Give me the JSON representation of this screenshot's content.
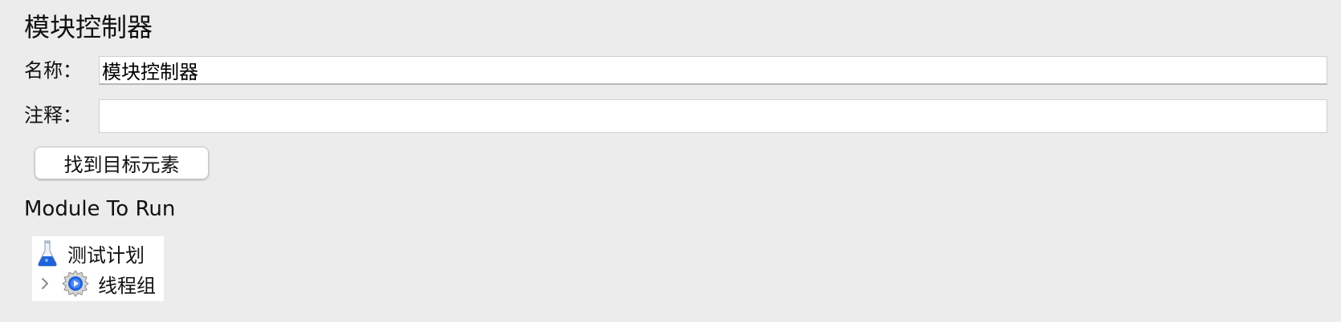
{
  "panel": {
    "title": "模块控制器",
    "name_label": "名称：",
    "name_value": "模块控制器",
    "comment_label": "注释：",
    "comment_value": "",
    "find_button_label": "找到目标元素",
    "module_section_label": "Module To Run"
  },
  "tree": {
    "items": [
      {
        "label": "测试计划",
        "icon": "flask-icon",
        "expandable": false
      },
      {
        "label": "线程组",
        "icon": "gear-icon",
        "expandable": true,
        "expanded": false
      }
    ]
  },
  "colors": {
    "background": "#ececec",
    "input_background": "#ffffff",
    "icon_blue": "#1f63d9"
  }
}
